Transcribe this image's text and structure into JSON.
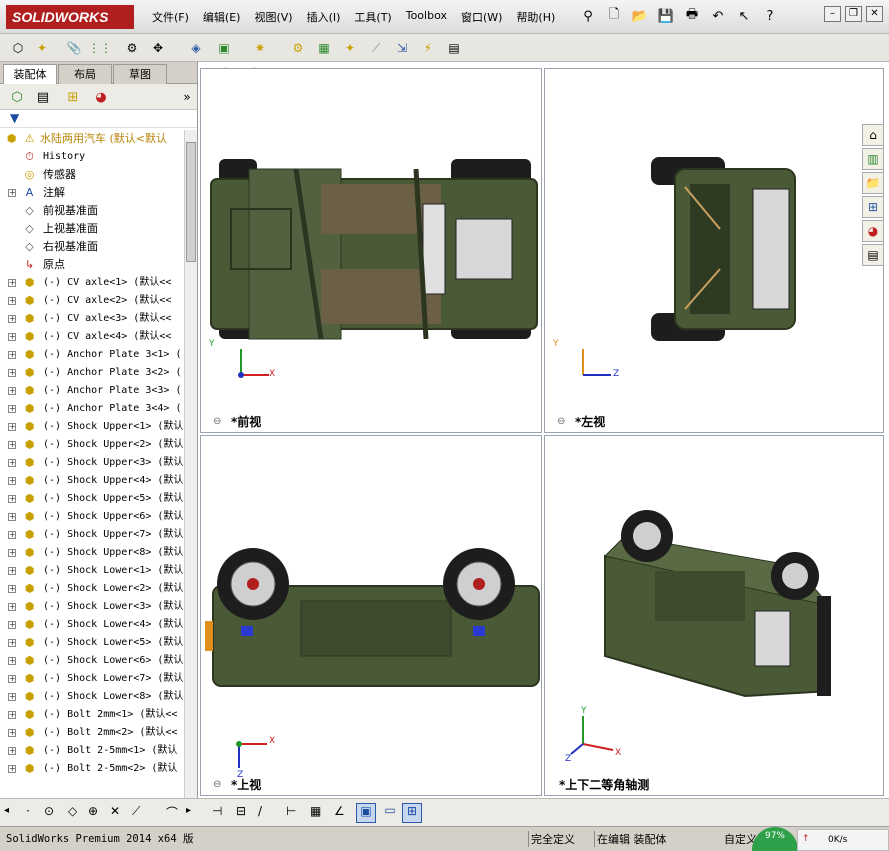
{
  "app": {
    "logo_text": "SOLIDWORKS",
    "menu": [
      "文件(F)",
      "编辑(E)",
      "视图(V)",
      "插入(I)",
      "工具(T)",
      "Toolbox",
      "窗口(W)",
      "帮助(H)"
    ]
  },
  "sidebar": {
    "tabs": [
      "装配体",
      "布局",
      "草图"
    ],
    "tree_root": "水陆两用汽车  (默认<默认",
    "items": [
      {
        "label": "History",
        "icon": "history-icon",
        "expand": false,
        "mono": true
      },
      {
        "label": "传感器",
        "icon": "sensor-icon",
        "expand": false,
        "mono": false
      },
      {
        "label": "注解",
        "icon": "annotation-icon",
        "expand": true,
        "mono": false
      },
      {
        "label": "前视基准面",
        "icon": "plane-icon",
        "expand": false,
        "mono": false
      },
      {
        "label": "上视基准面",
        "icon": "plane-icon",
        "expand": false,
        "mono": false
      },
      {
        "label": "右视基准面",
        "icon": "plane-icon",
        "expand": false,
        "mono": false
      },
      {
        "label": "原点",
        "icon": "origin-icon",
        "expand": false,
        "mono": false
      },
      {
        "label": "(-) CV axle<1> (默认<<",
        "icon": "part-icon",
        "expand": true,
        "mono": true
      },
      {
        "label": "(-) CV axle<2> (默认<<",
        "icon": "part-icon",
        "expand": true,
        "mono": true
      },
      {
        "label": "(-) CV axle<3> (默认<<",
        "icon": "part-icon",
        "expand": true,
        "mono": true
      },
      {
        "label": "(-) CV axle<4> (默认<<",
        "icon": "part-icon",
        "expand": true,
        "mono": true
      },
      {
        "label": "(-) Anchor Plate 3<1> (",
        "icon": "part-icon",
        "expand": true,
        "mono": true
      },
      {
        "label": "(-) Anchor Plate 3<2> (",
        "icon": "part-icon",
        "expand": true,
        "mono": true
      },
      {
        "label": "(-) Anchor Plate 3<3> (",
        "icon": "part-icon",
        "expand": true,
        "mono": true
      },
      {
        "label": "(-) Anchor Plate 3<4> (",
        "icon": "part-icon",
        "expand": true,
        "mono": true
      },
      {
        "label": "(-) Shock Upper<1> (默认",
        "icon": "part-icon",
        "expand": true,
        "mono": true
      },
      {
        "label": "(-) Shock Upper<2> (默认",
        "icon": "part-icon",
        "expand": true,
        "mono": true
      },
      {
        "label": "(-) Shock Upper<3> (默认",
        "icon": "part-icon",
        "expand": true,
        "mono": true
      },
      {
        "label": "(-) Shock Upper<4> (默认",
        "icon": "part-icon",
        "expand": true,
        "mono": true
      },
      {
        "label": "(-) Shock Upper<5> (默认",
        "icon": "part-icon",
        "expand": true,
        "mono": true
      },
      {
        "label": "(-) Shock Upper<6> (默认",
        "icon": "part-icon",
        "expand": true,
        "mono": true
      },
      {
        "label": "(-) Shock Upper<7> (默认",
        "icon": "part-icon",
        "expand": true,
        "mono": true
      },
      {
        "label": "(-) Shock Upper<8> (默认",
        "icon": "part-icon",
        "expand": true,
        "mono": true
      },
      {
        "label": "(-) Shock Lower<1> (默认",
        "icon": "part-icon",
        "expand": true,
        "mono": true
      },
      {
        "label": "(-) Shock Lower<2> (默认",
        "icon": "part-icon",
        "expand": true,
        "mono": true
      },
      {
        "label": "(-) Shock Lower<3> (默认",
        "icon": "part-icon",
        "expand": true,
        "mono": true
      },
      {
        "label": "(-) Shock Lower<4> (默认",
        "icon": "part-icon",
        "expand": true,
        "mono": true
      },
      {
        "label": "(-) Shock Lower<5> (默认",
        "icon": "part-icon",
        "expand": true,
        "mono": true
      },
      {
        "label": "(-) Shock Lower<6> (默认",
        "icon": "part-icon",
        "expand": true,
        "mono": true
      },
      {
        "label": "(-) Shock Lower<7> (默认",
        "icon": "part-icon",
        "expand": true,
        "mono": true
      },
      {
        "label": "(-) Shock Lower<8> (默认",
        "icon": "part-icon",
        "expand": true,
        "mono": true
      },
      {
        "label": "(-) Bolt 2mm<1> (默认<<",
        "icon": "part-icon",
        "expand": true,
        "mono": true
      },
      {
        "label": "(-) Bolt 2mm<2> (默认<<",
        "icon": "part-icon",
        "expand": true,
        "mono": true
      },
      {
        "label": "(-) Bolt 2-5mm<1> (默认",
        "icon": "part-icon",
        "expand": true,
        "mono": true
      },
      {
        "label": "(-) Bolt 2-5mm<2> (默认",
        "icon": "part-icon",
        "expand": true,
        "mono": true
      }
    ]
  },
  "viewports": {
    "front": "*前视",
    "left": "*左视",
    "top": "*上视",
    "iso": "*上下二等角轴测",
    "axis_x": "X",
    "axis_y": "Y",
    "axis_z": "Z"
  },
  "status": {
    "version": "SolidWorks Premium 2014 x64 版",
    "fully_defined": "完全定义",
    "editing": "在编辑 装配体",
    "custom": "自定义",
    "badge": "97%",
    "upload": "0K/s"
  },
  "colors": {
    "accent_red": "#b01e1e",
    "body_green": "#4a5a36"
  }
}
